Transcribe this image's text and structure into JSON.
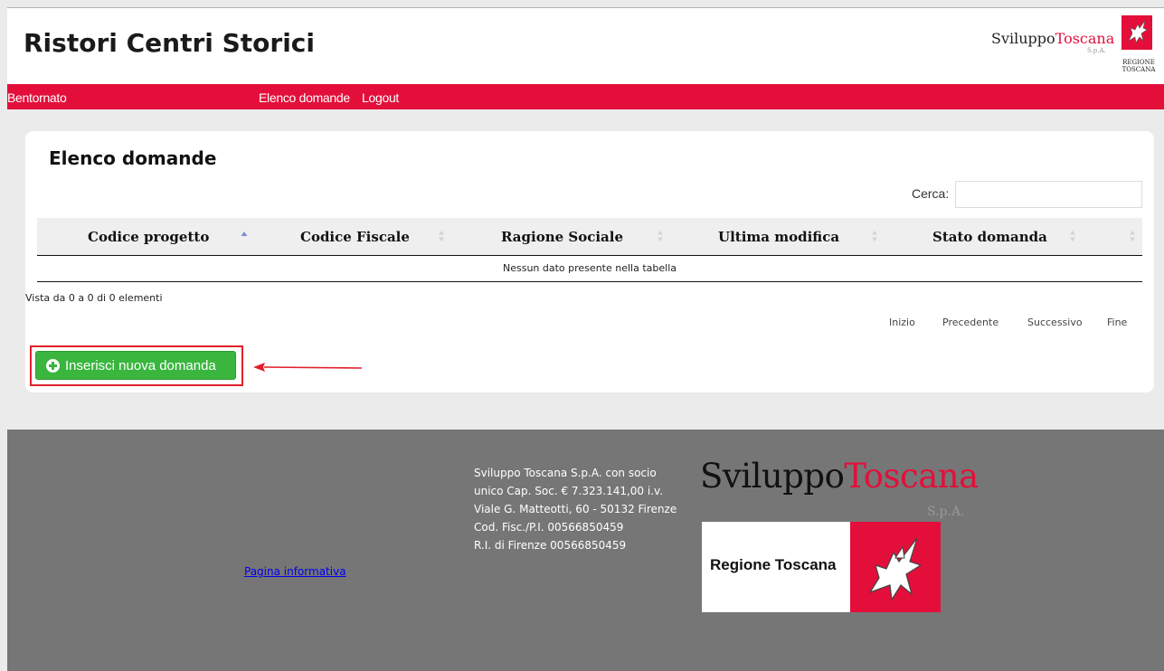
{
  "header": {
    "title": "Ristori Centri Storici",
    "logo_sviluppo_part1": "Sviluppo",
    "logo_sviluppo_part2": "Toscana",
    "logo_spa": "S.p.A.",
    "regione_logo_line1": "REGIONE",
    "regione_logo_line2": "TOSCANA"
  },
  "nav": {
    "welcome": "Bentornato",
    "elenco": "Elenco domande",
    "logout": "Logout"
  },
  "main": {
    "title": "Elenco domande",
    "search_label": "Cerca:",
    "search_value": "",
    "columns": [
      {
        "label": "Codice progetto",
        "sort": "asc"
      },
      {
        "label": "Codice Fiscale",
        "sort": "none"
      },
      {
        "label": "Ragione Sociale",
        "sort": "none"
      },
      {
        "label": "Ultima modifica",
        "sort": "none"
      },
      {
        "label": "Stato domanda",
        "sort": "none"
      },
      {
        "label": "",
        "sort": "none"
      }
    ],
    "empty_message": "Nessun dato presente nella tabella",
    "info": "Vista da 0 a 0 di 0 elementi",
    "pagination": {
      "first": "Inizio",
      "previous": "Precedente",
      "next": "Successivo",
      "last": "Fine"
    },
    "add_button": "Inserisci nuova domanda"
  },
  "footer": {
    "link": "Pagina informativa",
    "info_lines": [
      "Sviluppo Toscana S.p.A. con socio",
      "unico Cap. Soc. € 7.323.141,00 i.v.",
      "Viale G. Matteotti, 60 - 50132 Firenze",
      "Cod. Fisc./P.I. 00566850459",
      "R.I. di Firenze 00566850459"
    ],
    "logo_part1": "Sviluppo",
    "logo_part2": "Toscana",
    "logo_spa": "S.p.A.",
    "regione_box": "Regione Toscana"
  },
  "colors": {
    "brand_red": "#e30f3a",
    "button_green": "#3ab63f",
    "footer_gray": "#767676",
    "page_bg": "#ebebeb",
    "sort_active": "#7b8fd6",
    "sort_inactive": "#d3d3d3"
  }
}
